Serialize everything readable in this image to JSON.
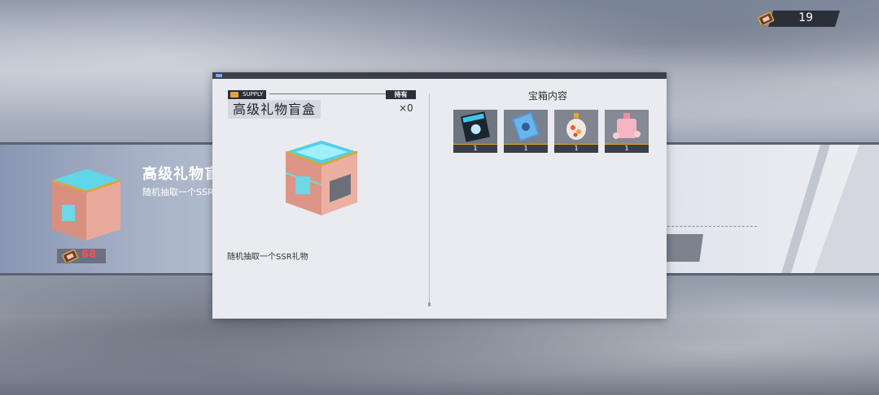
{
  "currency": {
    "count": "19"
  },
  "background_card": {
    "title": "高级礼物盲",
    "description": "随机抽取一个SSR",
    "price": "68"
  },
  "modal": {
    "tag": "SUPPLY",
    "owned_label": "持有",
    "item_title": "高级礼物盲盒",
    "owned_count": "×0",
    "description": "随机抽取一个SSR礼物",
    "contents_title": "宝箱内容",
    "contents": [
      {
        "icon": "tech-book-icon",
        "quantity": "1"
      },
      {
        "icon": "blue-notebook-icon",
        "quantity": "1"
      },
      {
        "icon": "candy-jar-icon",
        "quantity": "1"
      },
      {
        "icon": "perfume-bottle-icon",
        "quantity": "1"
      }
    ]
  },
  "colors": {
    "accent": "#e3a636",
    "price": "#ff5050",
    "dark": "#2b2f39"
  }
}
